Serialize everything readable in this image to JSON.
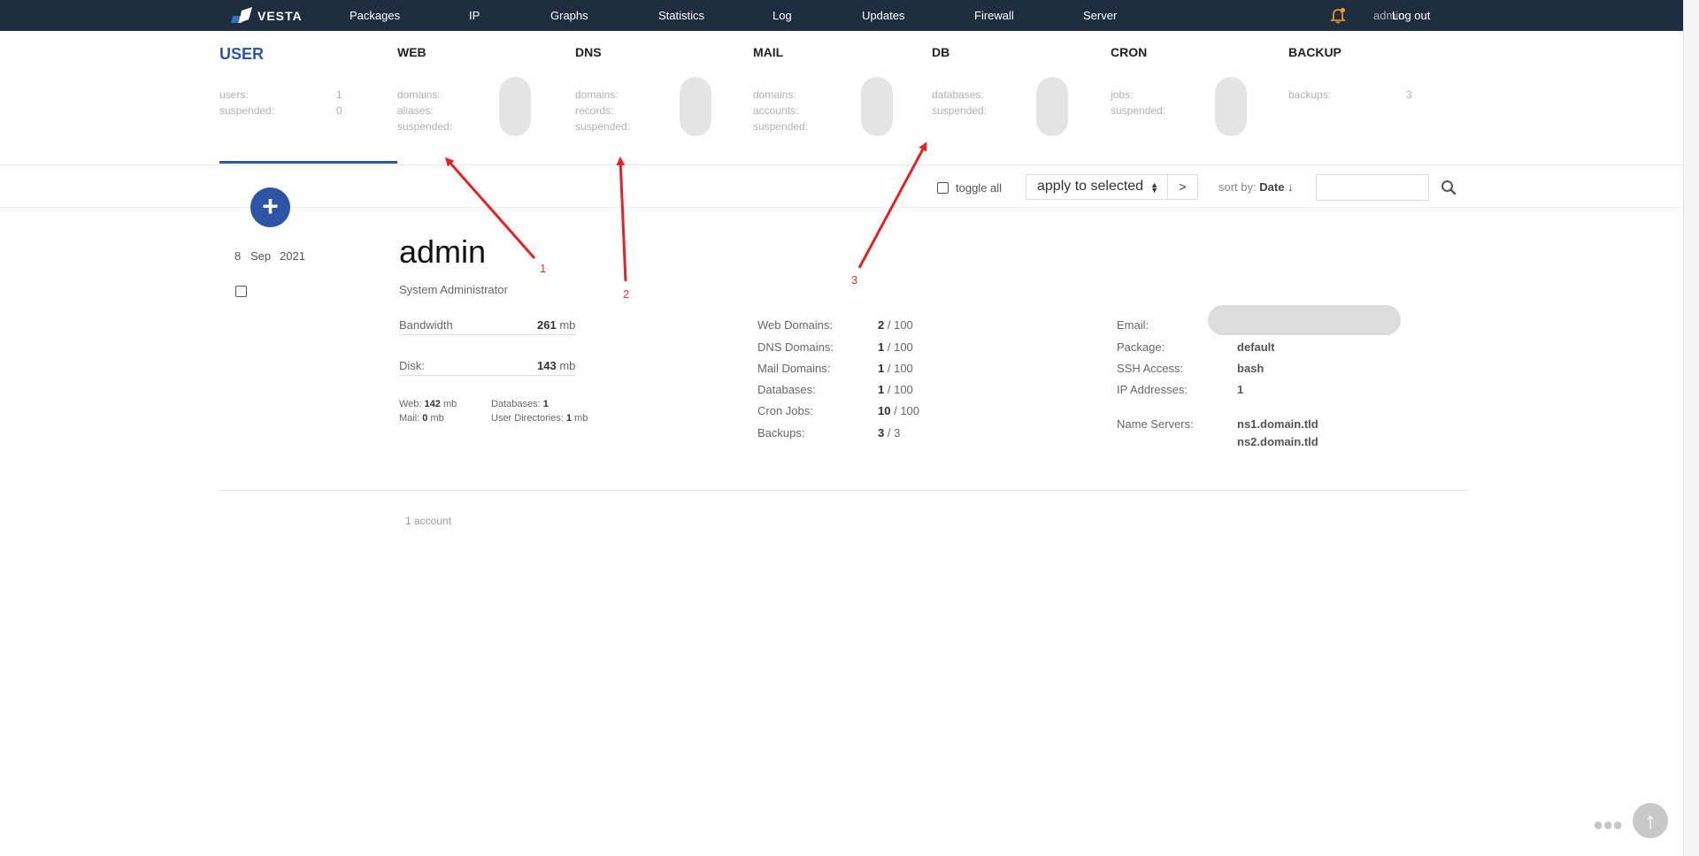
{
  "nav": {
    "brand": "VESTA",
    "links": [
      "Packages",
      "IP",
      "Graphs",
      "Statistics",
      "Log",
      "Updates",
      "Firewall",
      "Server"
    ],
    "user": "admin",
    "logout": "Log out"
  },
  "tabs": {
    "user": {
      "title": "USER",
      "labels": [
        "users:",
        "suspended:"
      ],
      "values": [
        "1",
        "0"
      ]
    },
    "web": {
      "title": "WEB",
      "labels": [
        "domains:",
        "aliases:",
        "suspended:"
      ]
    },
    "dns": {
      "title": "DNS",
      "labels": [
        "domains:",
        "records:",
        "suspended:"
      ]
    },
    "mail": {
      "title": "MAIL",
      "labels": [
        "domains:",
        "accounts:",
        "suspended:"
      ]
    },
    "db": {
      "title": "DB",
      "labels": [
        "databases:",
        "suspended:"
      ]
    },
    "cron": {
      "title": "CRON",
      "labels": [
        "jobs:",
        "suspended:"
      ]
    },
    "backup": {
      "title": "BACKUP",
      "labels": [
        "backups:"
      ],
      "values": [
        "3"
      ]
    }
  },
  "toolbar": {
    "add": "+",
    "toggle_all": "toggle all",
    "apply": "apply to selected",
    "go": ">",
    "sort_prefix": "sort by:",
    "sort_value": "Date ↓"
  },
  "user_row": {
    "date": {
      "day": "8",
      "month": "Sep",
      "year": "2021"
    },
    "username": "admin",
    "fullname": "System Administrator",
    "bandwidth": {
      "label": "Bandwidth",
      "value": "261",
      "unit": "mb"
    },
    "disk": {
      "label": "Disk:",
      "value": "143",
      "unit": "mb"
    },
    "breakdown": {
      "web": {
        "label": "Web:",
        "value": "142",
        "unit": "mb"
      },
      "mail": {
        "label": "Mail:",
        "value": "0",
        "unit": "mb"
      },
      "databases": {
        "label": "Databases:",
        "value": "1"
      },
      "user_dirs": {
        "label": "User Directories:",
        "value": "1",
        "unit": "mb"
      }
    },
    "limits": [
      {
        "label": "Web Domains:",
        "used": "2",
        "max": "/ 100"
      },
      {
        "label": "DNS Domains:",
        "used": "1",
        "max": "/ 100"
      },
      {
        "label": "Mail Domains:",
        "used": "1",
        "max": "/ 100"
      },
      {
        "label": "Databases:",
        "used": "1",
        "max": "/ 100"
      },
      {
        "label": "Cron Jobs:",
        "used": "10",
        "max": "/ 100"
      },
      {
        "label": "Backups:",
        "used": "3",
        "max": "/ 3"
      }
    ],
    "details": {
      "email_label": "Email:",
      "package_label": "Package:",
      "package": "default",
      "ssh_label": "SSH Access:",
      "ssh": "bash",
      "ip_label": "IP Addresses:",
      "ip": "1",
      "ns_label": "Name Servers:",
      "ns1": "ns1.domain.tld",
      "ns2": "ns2.domain.tld"
    }
  },
  "footer": {
    "count": "1 account"
  },
  "annotations": [
    "1",
    "2",
    "3"
  ],
  "colors": {
    "nav_bg": "#1e2d3f",
    "accent": "#2c55a8",
    "annotation": "#e32222",
    "bell": "#f0a020"
  }
}
